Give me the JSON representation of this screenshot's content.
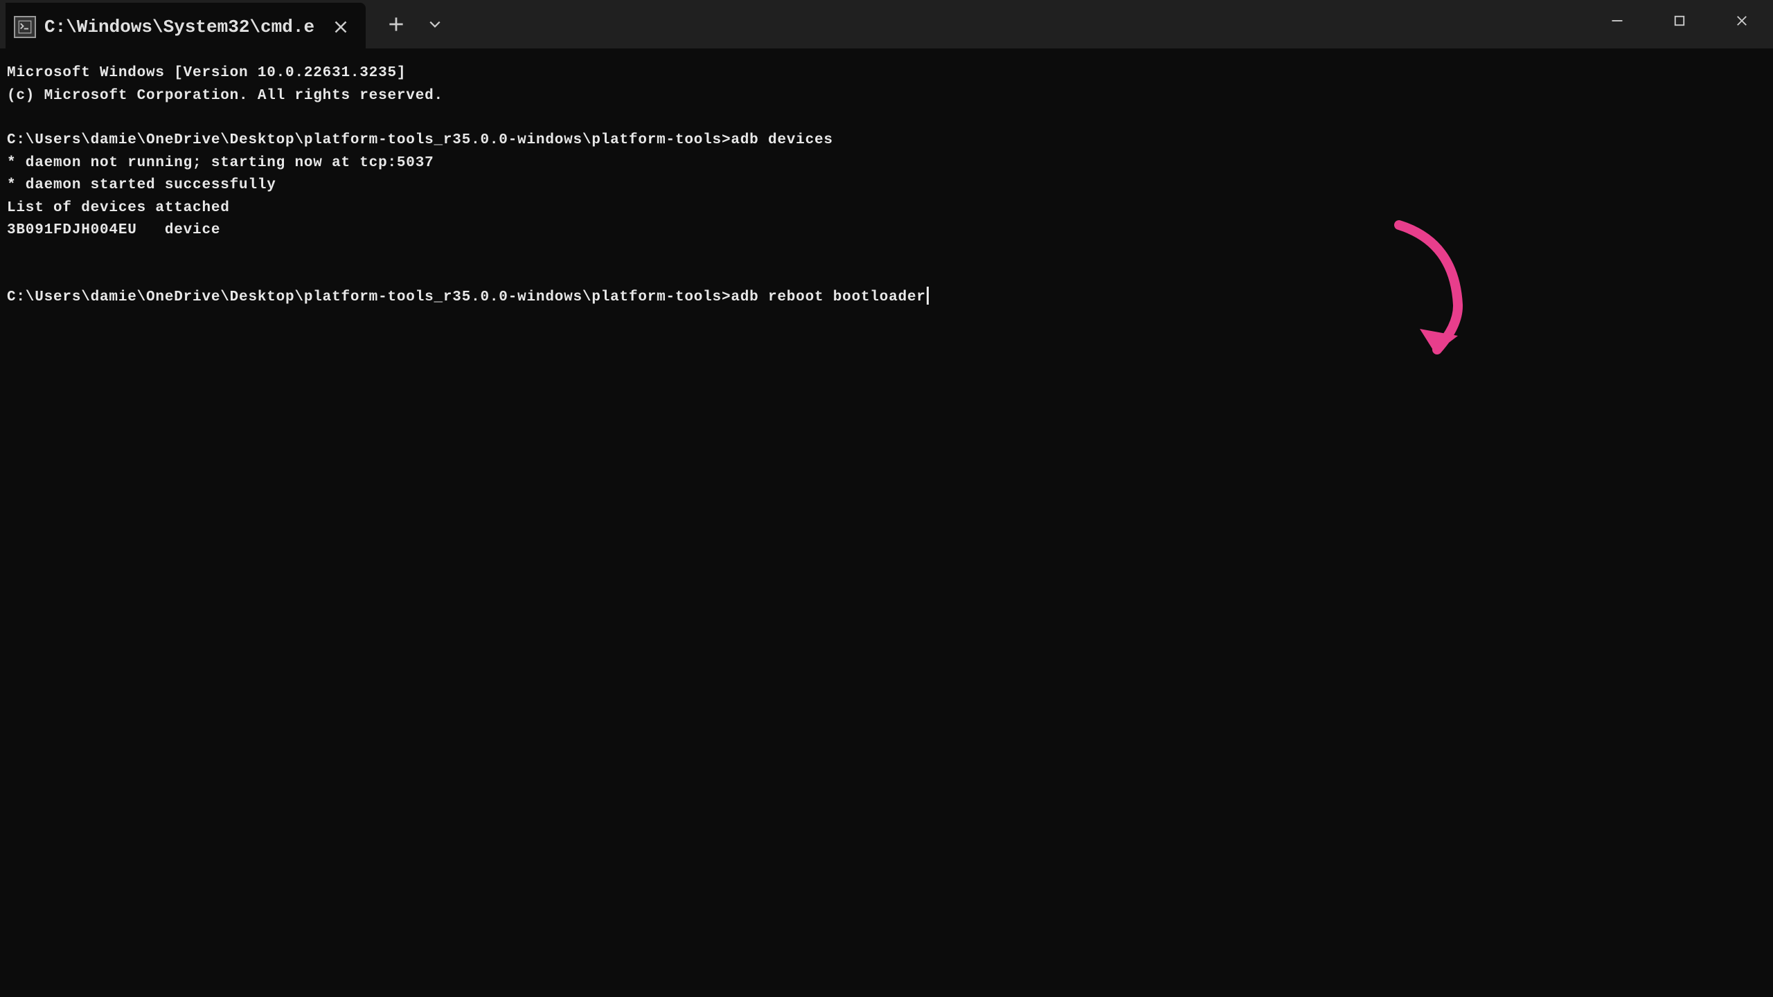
{
  "titlebar": {
    "tab_title": "C:\\Windows\\System32\\cmd.e",
    "tab_icon_label": "cmd-icon"
  },
  "terminal": {
    "header": {
      "line1": "Microsoft Windows [Version 10.0.22631.3235]",
      "line2": "(c) Microsoft Corporation. All rights reserved."
    },
    "session1": {
      "prompt": "C:\\Users\\damie\\OneDrive\\Desktop\\platform-tools_r35.0.0-windows\\platform-tools>",
      "command": "adb devices",
      "out1": "* daemon not running; starting now at tcp:5037",
      "out2": "* daemon started successfully",
      "out3": "List of devices attached",
      "out4": "3B091FDJH004EU   device"
    },
    "session2": {
      "prompt": "C:\\Users\\damie\\OneDrive\\Desktop\\platform-tools_r35.0.0-windows\\platform-tools>",
      "command": "adb reboot bootloader"
    }
  },
  "annotation": {
    "arrow_color": "#e83e8c"
  }
}
